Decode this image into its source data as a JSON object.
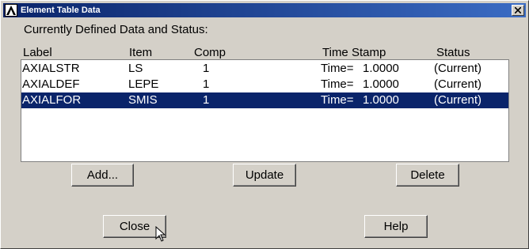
{
  "window": {
    "title": "Element Table Data",
    "close_glyph": "×"
  },
  "heading": "Currently Defined Data and Status:",
  "columns": {
    "label": "Label",
    "item": "Item",
    "comp": "Comp",
    "time_stamp": "Time Stamp",
    "status": "Status"
  },
  "rows": [
    {
      "label": "AXIALSTR",
      "item": "LS",
      "comp": "1",
      "time_prefix": "Time=",
      "time_value": "1.0000",
      "status": "(Current)",
      "selected": false
    },
    {
      "label": "AXIALDEF",
      "item": "LEPE",
      "comp": "1",
      "time_prefix": "Time=",
      "time_value": "1.0000",
      "status": "(Current)",
      "selected": false
    },
    {
      "label": "AXIALFOR",
      "item": "SMIS",
      "comp": "1",
      "time_prefix": "Time=",
      "time_value": "1.0000",
      "status": "(Current)",
      "selected": true
    }
  ],
  "buttons": {
    "add": "Add...",
    "update": "Update",
    "delete": "Delete",
    "close": "Close",
    "help": "Help"
  },
  "colors": {
    "titlebar_start": "#0a246a",
    "titlebar_end": "#3b6cc4",
    "selection": "#0a246a",
    "dialog_bg": "#d4d0c8"
  },
  "icons": {
    "app": "ansys-logo-icon",
    "close": "close-icon",
    "cursor": "mouse-pointer-icon"
  }
}
